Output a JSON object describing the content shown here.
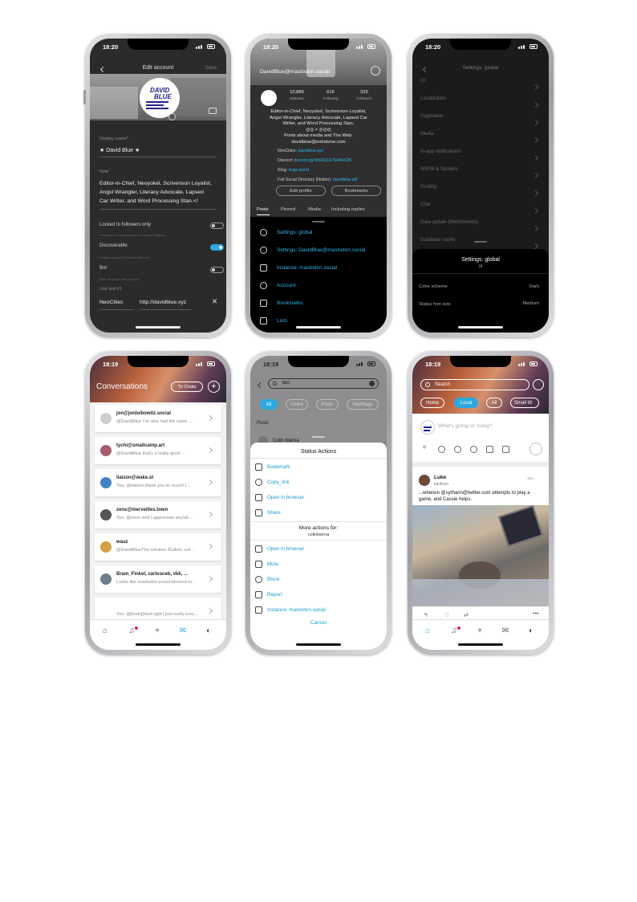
{
  "statusbar": {
    "time_a": "18:20",
    "time_b": "18:19"
  },
  "edit_account": {
    "title": "Edit account",
    "save": "Save",
    "display_name_label": "Display name*",
    "display_name": "★ David Blue ★",
    "note_label": "Note",
    "note_line1": "Editor-in-Chief, Neoyokel, Scrivenson Loyalist,",
    "note_line2": "Angst Wrangler, Literacy Advocate, Lapsed",
    "note_line3": "Car Writer, and Word Processing Stan.</",
    "locked_label": "Locked to followers only",
    "locked_desc": "You have to manually approve follow requests",
    "discoverable_label": "Discoverable",
    "discoverable_desc": "Feature account in Profile directory",
    "bot_label": "Bot",
    "bot_desc": "Mark as automated account",
    "link_label": "Link text #1",
    "link_name": "NeoCities",
    "link_url": "http://davidblue.xyz",
    "avatar_text_top": "DAVID",
    "avatar_text_bottom": "BLUE"
  },
  "profile": {
    "handle": "DavidBlue@mastodon.social",
    "stats": [
      {
        "value": "10,886",
        "label": "Statuses"
      },
      {
        "value": "616",
        "label": "Following"
      },
      {
        "value": "325",
        "label": "Followers"
      }
    ],
    "bio_line1": "Editor-in-Chief, Neoyokel, Scrivenson Loyalist,",
    "bio_line2": "Angst Wrangler, Literacy Advocate, Lapsed Car",
    "bio_line3": "Writer, and Word Processing Stan.",
    "bio_line4": "◎◎ ≈ ◎◎◎",
    "bio_line5": "Posts about media and The Web.",
    "bio_line6": "davidblue@extratone.com",
    "links": [
      {
        "name": "NeoCities:",
        "value": "davidblue.xyz"
      },
      {
        "name": "Discord:",
        "value": "discord.gg/WeRQLK7R48e02K"
      },
      {
        "name": "Ring:",
        "value": "ringe.world"
      },
      {
        "name": "Full Social Directory (Notion):",
        "value": "davidblue.wtf"
      }
    ],
    "edit_profile": "Edit profile",
    "bookmarks_btn": "Bookmarks",
    "tabs": [
      "Posts",
      "Pinned",
      "Media",
      "Including replies"
    ],
    "menu": [
      {
        "icon": "gear-icon",
        "label": "Settings: global"
      },
      {
        "icon": "gear-icon",
        "label": "Settings: DavidBlue@mastodon.social"
      },
      {
        "icon": "server-icon",
        "label": "Instance: mastodon.social"
      },
      {
        "icon": "person-icon",
        "label": "Account"
      },
      {
        "icon": "bookmark-icon",
        "label": "Bookmarks"
      },
      {
        "icon": "list-icon",
        "label": "Lists"
      }
    ]
  },
  "settings": {
    "title": "Settings: global",
    "rows": [
      "UI",
      "Localization",
      "Pagination",
      "Media",
      "In-app notifications",
      "NSFW & Spoilers",
      "Posting",
      "Chat",
      "Data update (WebSockets)",
      "Database cache"
    ],
    "sheet_title": "Settings: global",
    "sheet_sub": "UI",
    "color_scheme_label": "Color scheme",
    "color_scheme_value": "Dark",
    "font_size_label": "Status font size",
    "font_size_value": "Medium"
  },
  "conversations": {
    "title": "Conversations",
    "to_chats": "To Chats",
    "items": [
      {
        "name": "jon@jonleibowitz.social",
        "preview": "@DavidBlue I've also had the same ..."
      },
      {
        "name": "tychi@smallcamp.art",
        "preview": "@DavidBlue that's a really good ..."
      },
      {
        "name": "liaizon@wake.st",
        "preview": "You: @liaizon thank you so much! I ..."
      },
      {
        "name": "zens@merveilles.town",
        "preview": "You: @zens well I appreciate any/all ..."
      },
      {
        "name": "wauz",
        "preview": "@DavidBlueThe solution: Bullets, not ..."
      },
      {
        "name": "Bram_Finkel, carlosceb, vkk, ...",
        "preview": "Looks like mastodon.social blocked m..."
      },
      {
        "name": "",
        "preview": "You: @Endi@tech.lgbt I just really love..."
      }
    ]
  },
  "search": {
    "query": "leci",
    "chips": [
      "All",
      "Users",
      "Posts",
      "Hashtags"
    ],
    "section": "Posts",
    "result_name": "Colin Kierna",
    "sheet_title": "Status Actions",
    "actions": [
      {
        "icon": "bookmark-icon",
        "label": "Bookmark"
      },
      {
        "icon": "link-icon",
        "label": "Copy_link"
      },
      {
        "icon": "browser-icon",
        "label": "Open in browser"
      },
      {
        "icon": "share-icon",
        "label": "Share"
      }
    ],
    "more_title": "More actions for:",
    "more_user": "colinkierna",
    "more_actions": [
      {
        "icon": "browser-icon",
        "label": "Open in browser"
      },
      {
        "icon": "mute-icon",
        "label": "Mute"
      },
      {
        "icon": "block-icon",
        "label": "Block"
      },
      {
        "icon": "warning-icon",
        "label": "Report"
      },
      {
        "icon": "server-icon",
        "label": "Instance: mastodon.social"
      }
    ],
    "cancel": "Cancel"
  },
  "timeline": {
    "search_placeholder": "Search",
    "pills": [
      "Home",
      "Local",
      "All",
      "Small W"
    ],
    "compose_placeholder": "What's going on today?",
    "post_author": "Luke",
    "post_handle": "lukibrun",
    "post_age": "16m",
    "post_text_1": "...wherein @sytharin@twitter.com attempts to play a",
    "post_text_2": "game, and Cassie helps."
  }
}
